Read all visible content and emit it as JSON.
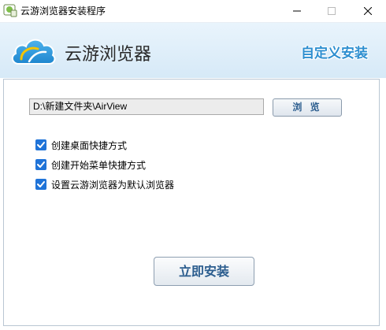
{
  "window": {
    "title": "云游浏览器安装程序",
    "icons": [
      "app-icon",
      "minimize-icon",
      "maximize-icon",
      "close-icon"
    ]
  },
  "header": {
    "brand": "云游浏览器",
    "custom_install": "自定义安装",
    "logo": "cloud-logo-icon"
  },
  "install_path": {
    "value": "D:\\新建文件夹\\AirView"
  },
  "browse_button": "浏 览",
  "options": [
    {
      "label": "创建桌面快捷方式",
      "checked": true
    },
    {
      "label": "创建开始菜单快捷方式",
      "checked": true
    },
    {
      "label": "设置云游浏览器为默认浏览器",
      "checked": true
    }
  ],
  "install_button": "立即安装",
  "colors": {
    "accent": "#2e8fd0",
    "checkbox": "#1f73d8",
    "header_bg": "#d6e9f7",
    "button_text": "#2b5d8e"
  }
}
